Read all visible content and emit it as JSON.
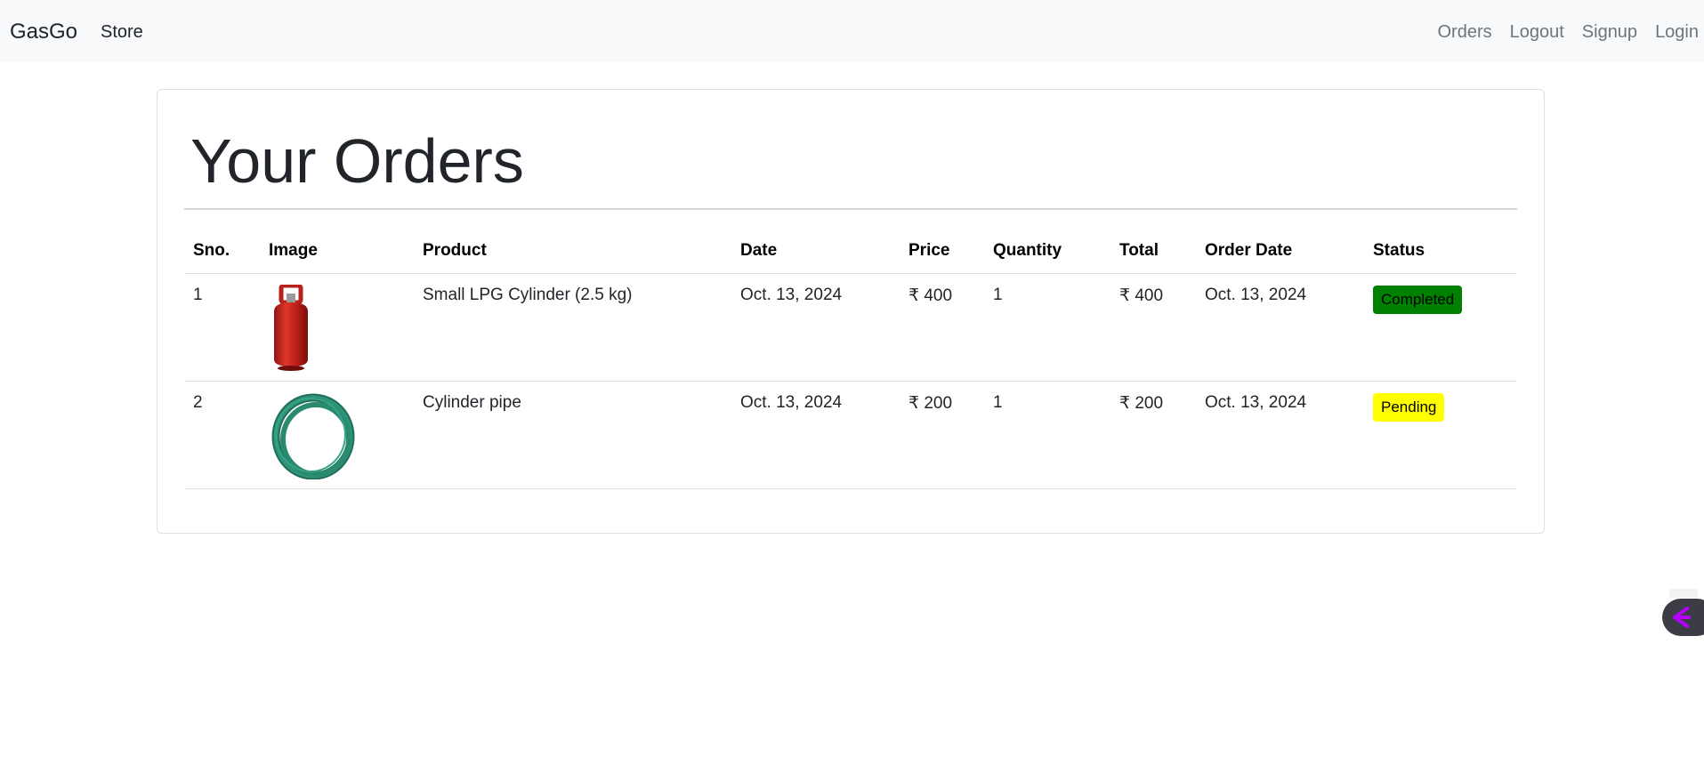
{
  "navbar": {
    "brand": "GasGo",
    "left_links": [
      "Store"
    ],
    "right_links": [
      "Orders",
      "Logout",
      "Signup",
      "Login"
    ]
  },
  "main": {
    "title": "Your Orders",
    "table": {
      "headers": [
        "Sno.",
        "Image",
        "Product",
        "Date",
        "Price",
        "Quantity",
        "Total",
        "Order Date",
        "Status"
      ],
      "rows": [
        {
          "sno": "1",
          "image": "red-gas-cylinder-image",
          "product": "Small LPG Cylinder (2.5 kg)",
          "date": "Oct. 13, 2024",
          "price": "₹ 400",
          "quantity": "1",
          "total": "₹ 400",
          "order_date": "Oct. 13, 2024",
          "status": "Completed",
          "status_color": "#008000"
        },
        {
          "sno": "2",
          "image": "green-hose-pipe-image",
          "product": "Cylinder pipe",
          "date": "Oct. 13, 2024",
          "price": "₹ 200",
          "quantity": "1",
          "total": "₹ 200",
          "order_date": "Oct. 13, 2024",
          "status": "Pending",
          "status_color": "#ffff00"
        }
      ]
    }
  },
  "colors": {
    "navbar_bg": "#f8f9fa",
    "muted_link": "#6c757d",
    "completed": "#008000",
    "pending": "#ffff00"
  },
  "floating_widget": {
    "icon": "assistant-logo-icon"
  }
}
